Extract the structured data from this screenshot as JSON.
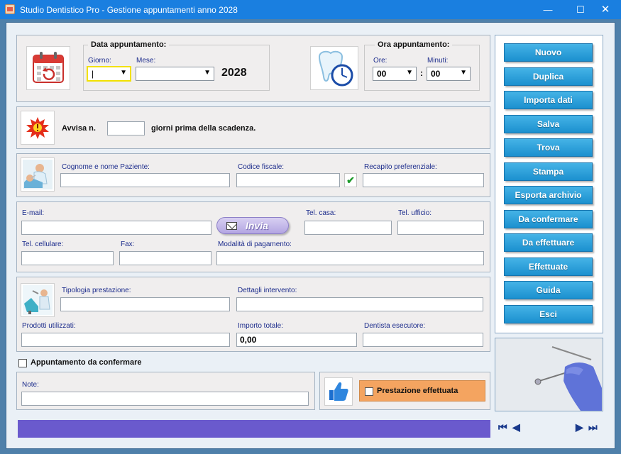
{
  "window": {
    "title": "Studio Dentistico Pro - Gestione appuntamenti anno 2028",
    "minimize": "—",
    "maximize": "☐",
    "close": "✕"
  },
  "date_group": {
    "title": "Data appuntamento:",
    "day_label": "Giorno:",
    "day_value": "|",
    "month_label": "Mese:",
    "month_value": "",
    "year": "2028"
  },
  "time_group": {
    "title": "Ora appuntamento:",
    "hours_label": "Ore:",
    "hours_value": "00",
    "minutes_label": "Minuti:",
    "minutes_value": "00",
    "separator": ":"
  },
  "reminder": {
    "prefix": "Avvisa n.",
    "value": "",
    "suffix": "giorni prima della scadenza."
  },
  "patient": {
    "name_label": "Cognome e nome Paziente:",
    "name_value": "",
    "fiscal_label": "Codice fiscale:",
    "fiscal_value": "",
    "check_glyph": "✔",
    "contact_label": "Recapito preferenziale:",
    "contact_value": ""
  },
  "contacts": {
    "email_label": "E-mail:",
    "email_value": "",
    "send_button": "Invia",
    "home_label": "Tel. casa:",
    "home_value": "",
    "office_label": "Tel. ufficio:",
    "office_value": "",
    "mobile_label": "Tel. cellulare:",
    "mobile_value": "",
    "fax_label": "Fax:",
    "fax_value": "",
    "payment_label": "Modalità di pagamento:",
    "payment_value": ""
  },
  "treatment": {
    "type_label": "Tipologia prestazione:",
    "type_value": "",
    "details_label": "Dettagli intervento:",
    "details_value": "",
    "products_label": "Prodotti utilizzati:",
    "products_value": "",
    "amount_label": "Importo totale:",
    "amount_value": "0,00",
    "dentist_label": "Dentista esecutore:",
    "dentist_value": ""
  },
  "confirm": {
    "label": "Appuntamento da confermare"
  },
  "notes": {
    "label": "Note:",
    "value": ""
  },
  "done": {
    "label": "Prestazione effettuata"
  },
  "side_buttons": [
    "Nuovo",
    "Duplica",
    "Importa dati",
    "Salva",
    "Trova",
    "Stampa",
    "Esporta archivio",
    "Da confermare",
    "Da effettuare",
    "Effettuate",
    "Guida",
    "Esci"
  ],
  "nav": {
    "first": "⏮",
    "prev": "◀",
    "next": "▶",
    "last": "⏭"
  },
  "colors": {
    "titlebar": "#1a7fe0",
    "button": "#1b90cf",
    "statusbar": "#6a5acd",
    "done_panel": "#f4a460"
  }
}
